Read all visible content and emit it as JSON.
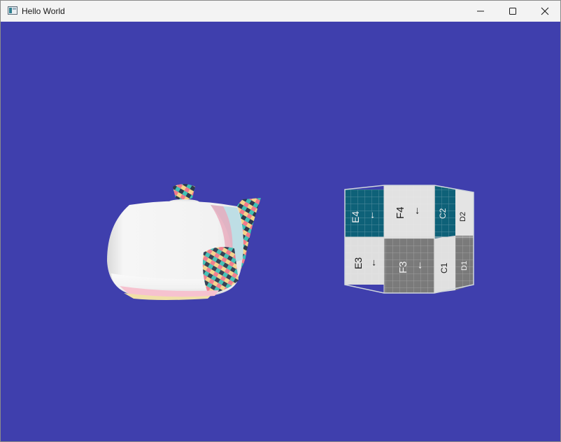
{
  "window": {
    "title": "Hello World"
  },
  "colors": {
    "viewport_background": "#3f3fad",
    "titlebar": "#f3f3f3",
    "teal_tile": "#0e6178",
    "gray_tile": "#7a7a7a",
    "light_tile": "#e2e2e2"
  },
  "icons": {
    "app": "app-icon",
    "minimize": "minimize-icon",
    "maximize": "maximize-icon",
    "close": "close-icon"
  },
  "scene": {
    "cube_labels": {
      "e4": "E4",
      "f4": "F4",
      "c2": "C2",
      "d2": "D2",
      "e3": "E3",
      "f3": "F3",
      "c1": "C1",
      "d1": "D1",
      "arrow": "←"
    }
  }
}
